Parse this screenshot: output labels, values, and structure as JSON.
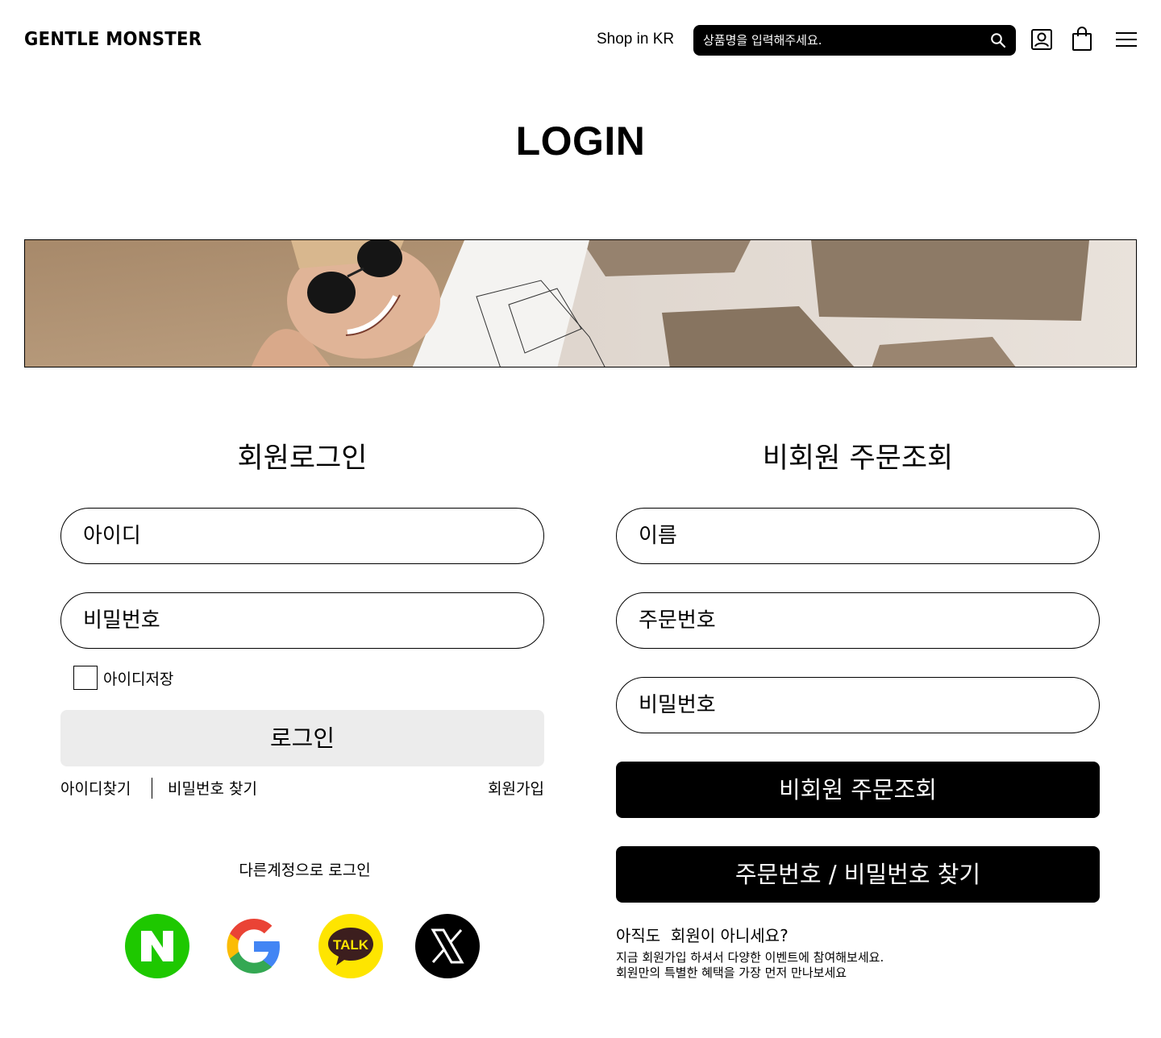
{
  "header": {
    "logo": "GENTLE MONSTER",
    "shop_region": "Shop in KR",
    "search_placeholder": "상품명을 입력해주세요.",
    "icons": [
      "search-icon",
      "user-icon",
      "shopping-bag-icon",
      "hamburger-menu-icon"
    ]
  },
  "page_title": "LOGIN",
  "member_login": {
    "title": "회원로그인",
    "id_placeholder": "아이디",
    "password_placeholder": "비밀번호",
    "remember_id_label": "아이디저장",
    "remember_id_checked": false,
    "login_button": "로그인",
    "find_id_link": "아이디찾기",
    "find_password_link": "비밀번호 찾기",
    "signup_link": "회원가입",
    "other_login_label": "다른계정으로 로그인",
    "social": [
      {
        "name": "naver",
        "icon": "naver-icon",
        "color": "#1ec800",
        "text": "N"
      },
      {
        "name": "google",
        "icon": "google-icon",
        "color": "#ffffff"
      },
      {
        "name": "kakao",
        "icon": "kakao-talk-icon",
        "color": "#fee500",
        "text": "TALK"
      },
      {
        "name": "x",
        "icon": "x-icon",
        "color": "#000000"
      }
    ]
  },
  "guest_order": {
    "title": "비회원 주문조회",
    "name_placeholder": "이름",
    "order_number_placeholder": "주문번호",
    "password_placeholder": "비밀번호",
    "lookup_button": "비회원 주문조회",
    "find_button": "주문번호 / 비밀번호 찾기",
    "promo_question": "아직도  회원이 아니세요?",
    "promo_line1": "지금 회원가입 하셔서 다양한 이벤트에 참여해보세요.",
    "promo_line2": "회원만의 특별한 혜택을 가장 먼저 만나보세요"
  },
  "colors": {
    "primary": "#000000",
    "secondary_button": "#ececec",
    "background": "#ffffff"
  }
}
